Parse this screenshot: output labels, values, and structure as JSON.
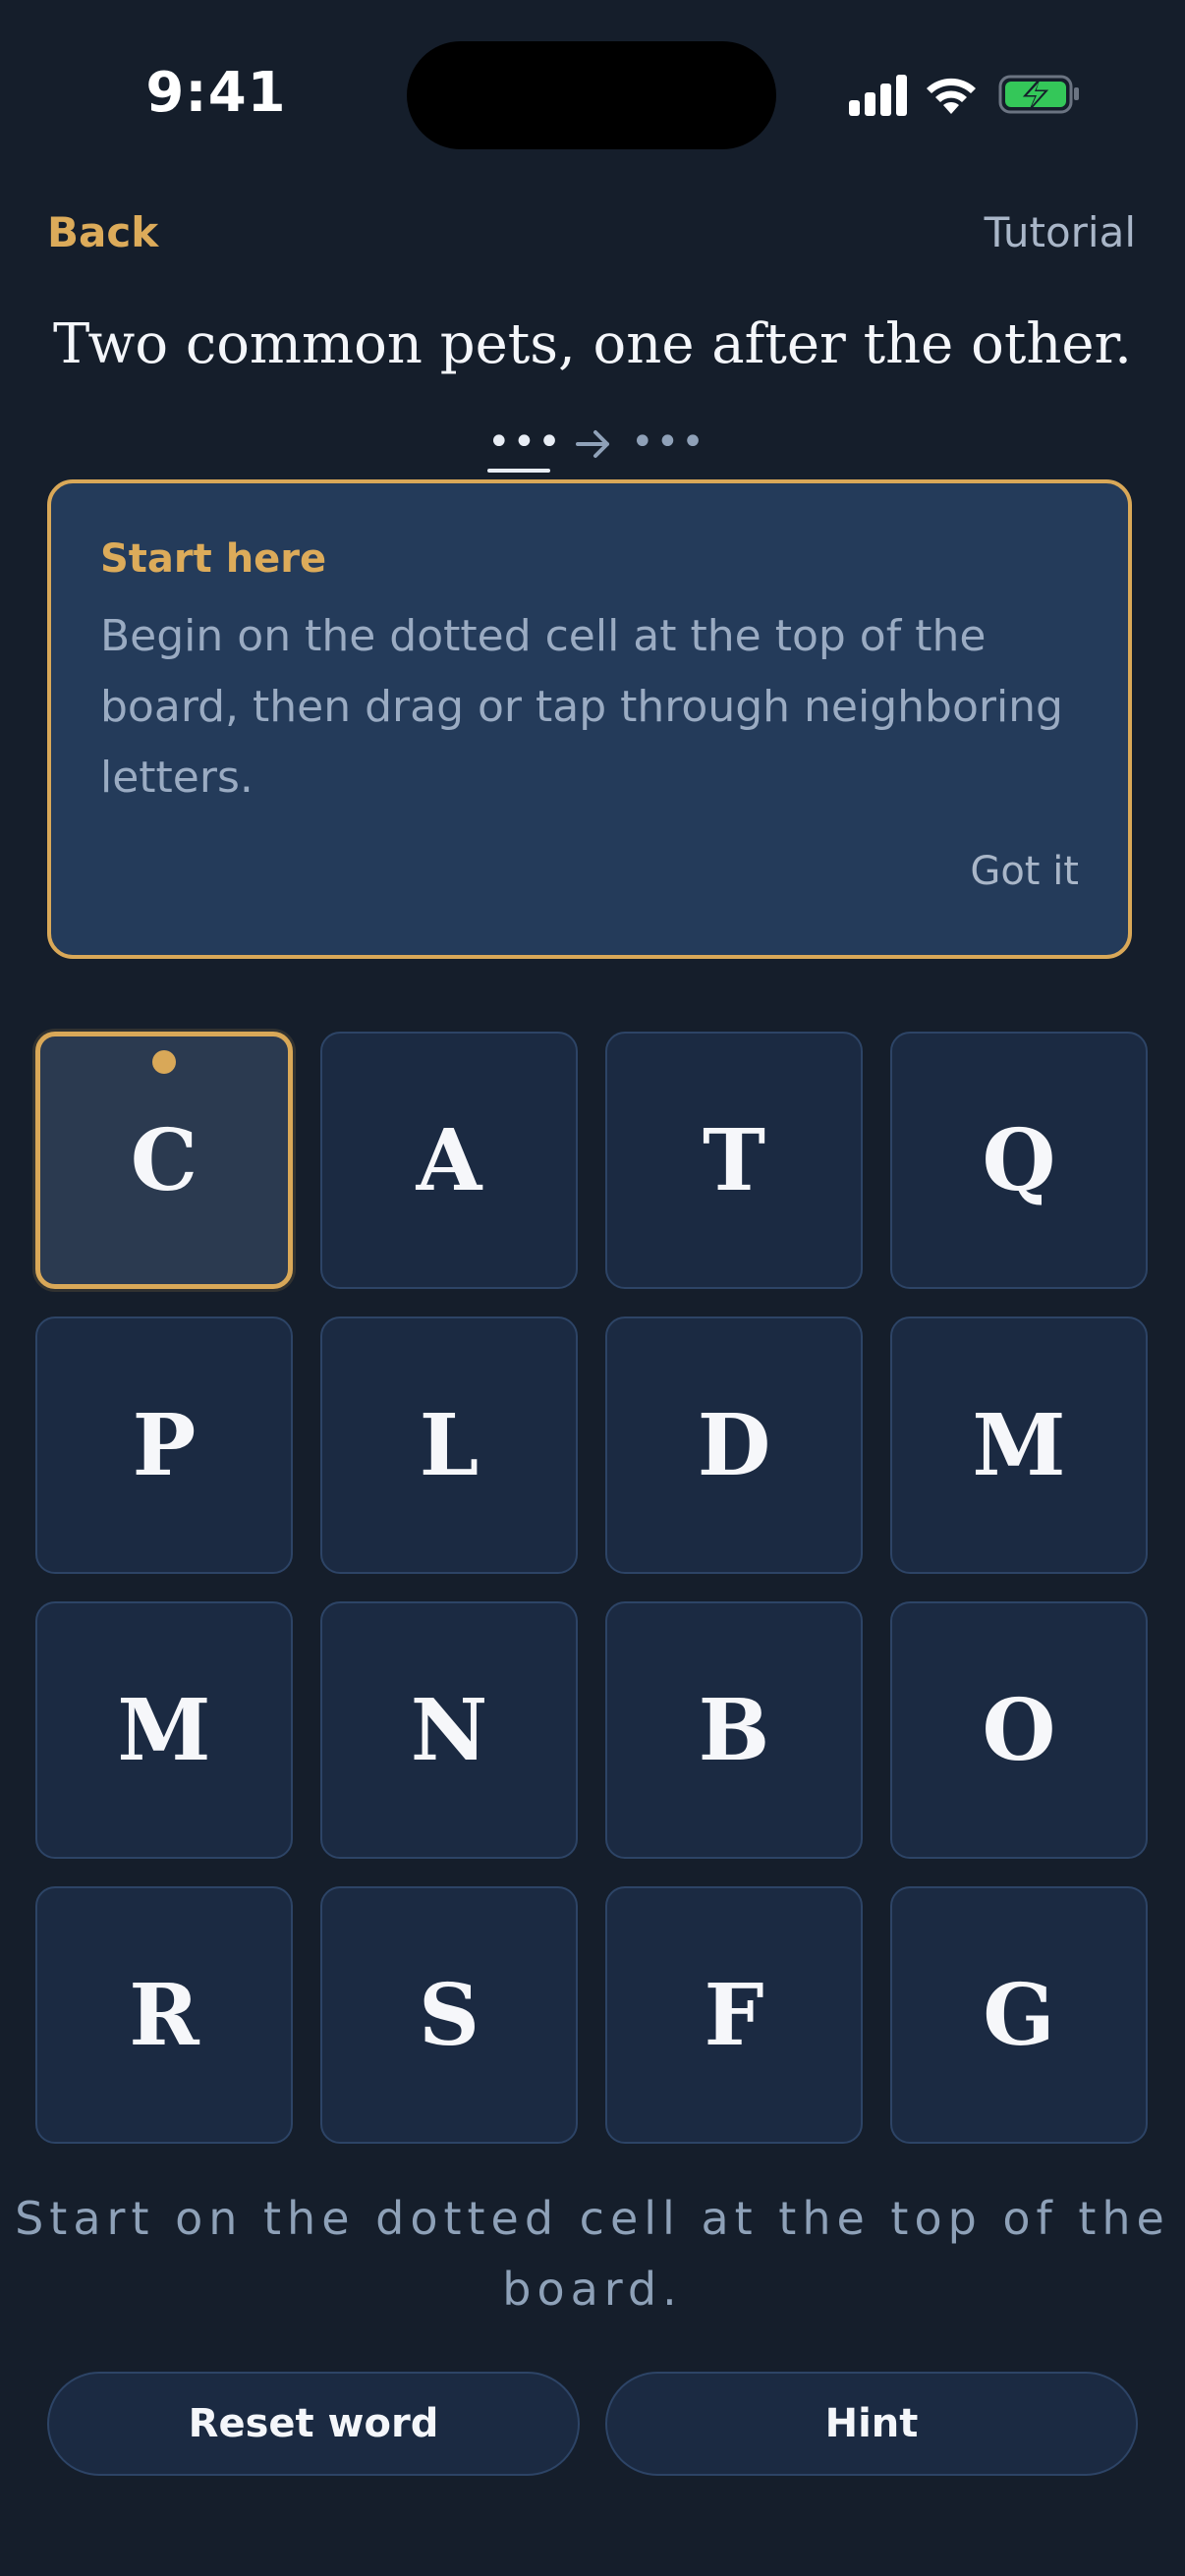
{
  "status_bar": {
    "time": "9:41",
    "icons": [
      "cellular-signal-icon",
      "wifi-icon",
      "battery-charging-icon"
    ],
    "battery_color": "#34c759"
  },
  "nav": {
    "back_label": "Back",
    "tutorial_label": "Tutorial"
  },
  "clue": {
    "text": "Two common pets, one after the other.",
    "pattern": {
      "first_word": "•••",
      "second_word": "•••",
      "arrow_icon": "arrow-right-icon"
    }
  },
  "tip": {
    "title": "Start here",
    "body": "Begin on the dotted cell at the top of the board, then drag or tap through neighboring letters.",
    "dismiss_label": "Got it"
  },
  "grid": {
    "rows": [
      [
        "C",
        "A",
        "T",
        "Q"
      ],
      [
        "P",
        "L",
        "D",
        "M"
      ],
      [
        "M",
        "N",
        "B",
        "O"
      ],
      [
        "R",
        "S",
        "F",
        "G"
      ]
    ],
    "start_cell": "C"
  },
  "instruction": "Start on the dotted cell at the top of the board.",
  "actions": {
    "reset_label": "Reset word",
    "hint_label": "Hint"
  },
  "colors": {
    "background": "#151e2b",
    "accent": "#d9a858",
    "cell": "#1b2a42",
    "card": "#243b5a"
  }
}
